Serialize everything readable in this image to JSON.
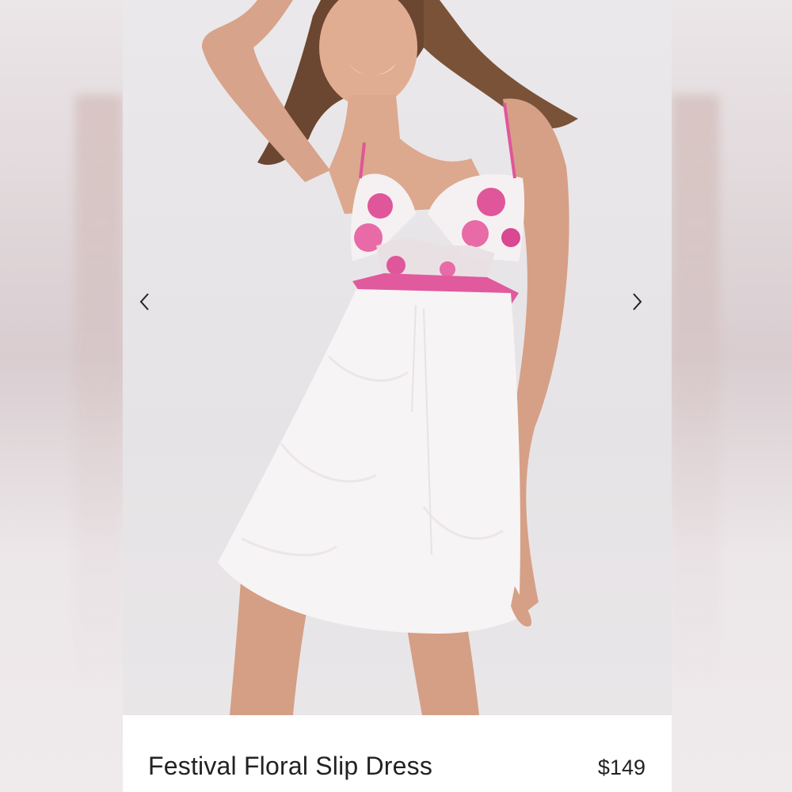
{
  "product": {
    "title": "Festival Floral Slip Dress",
    "price": "$149"
  },
  "carousel": {
    "prev_icon": "chevron-left-icon",
    "next_icon": "chevron-right-icon"
  },
  "colors": {
    "background": "#ece8ea",
    "card": "#ffffff",
    "text": "#222222",
    "accent_pink": "#e0569a"
  }
}
